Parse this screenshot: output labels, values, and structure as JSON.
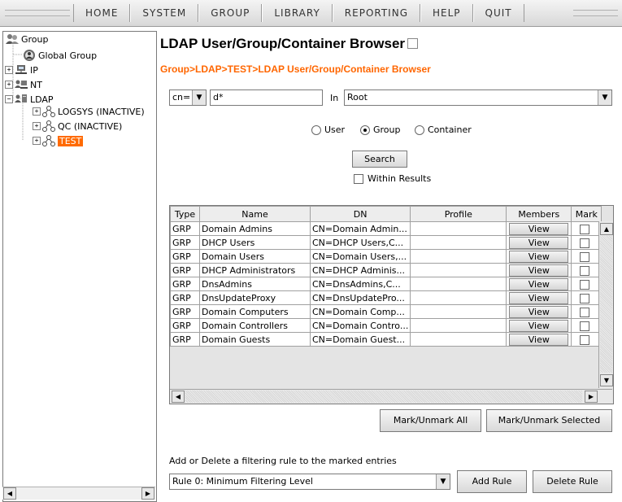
{
  "menu": [
    "HOME",
    "SYSTEM",
    "GROUP",
    "LIBRARY",
    "REPORTING",
    "HELP",
    "QUIT"
  ],
  "tree": {
    "root": "Group",
    "global": "Global Group",
    "ip": "IP",
    "nt": "NT",
    "ldap": "LDAP",
    "children": [
      "LOGSYS (INACTIVE)",
      "QC (INACTIVE)",
      "TEST"
    ]
  },
  "page": {
    "title": "LDAP User/Group/Container Browser",
    "breadcrumb": "Group>LDAP>TEST>LDAP User/Group/Container Browser"
  },
  "search": {
    "attr": "cn=",
    "value": "d*",
    "in_label": "In",
    "scope": "Root",
    "radios": [
      {
        "label": "User",
        "selected": false
      },
      {
        "label": "Group",
        "selected": true
      },
      {
        "label": "Container",
        "selected": false
      }
    ],
    "button": "Search",
    "within_results": "Within Results"
  },
  "table": {
    "headers": [
      "Type",
      "Name",
      "DN",
      "Profile",
      "Members",
      "Mark"
    ],
    "view_label": "View",
    "rows": [
      {
        "type": "GRP",
        "name": "Domain Admins",
        "dn": "CN=Domain Admin...",
        "profile": ""
      },
      {
        "type": "GRP",
        "name": "DHCP Users",
        "dn": "CN=DHCP Users,C...",
        "profile": ""
      },
      {
        "type": "GRP",
        "name": "Domain Users",
        "dn": "CN=Domain Users,...",
        "profile": ""
      },
      {
        "type": "GRP",
        "name": "DHCP Administrators",
        "dn": "CN=DHCP Adminis...",
        "profile": ""
      },
      {
        "type": "GRP",
        "name": "DnsAdmins",
        "dn": "CN=DnsAdmins,C...",
        "profile": ""
      },
      {
        "type": "GRP",
        "name": "DnsUpdateProxy",
        "dn": "CN=DnsUpdatePro...",
        "profile": ""
      },
      {
        "type": "GRP",
        "name": "Domain Computers",
        "dn": "CN=Domain Comp...",
        "profile": ""
      },
      {
        "type": "GRP",
        "name": "Domain Controllers",
        "dn": "CN=Domain Contro...",
        "profile": ""
      },
      {
        "type": "GRP",
        "name": "Domain Guests",
        "dn": "CN=Domain Guest...",
        "profile": ""
      }
    ]
  },
  "actions": {
    "mark_all": "Mark/Unmark All",
    "mark_selected": "Mark/Unmark Selected"
  },
  "filter": {
    "prompt": "Add or Delete a filtering rule to the marked entries",
    "rule": "Rule 0: Minimum Filtering Level",
    "add": "Add Rule",
    "delete": "Delete Rule"
  },
  "colors": {
    "accent": "#ff6600",
    "selected_bg": "#ff6a00"
  }
}
